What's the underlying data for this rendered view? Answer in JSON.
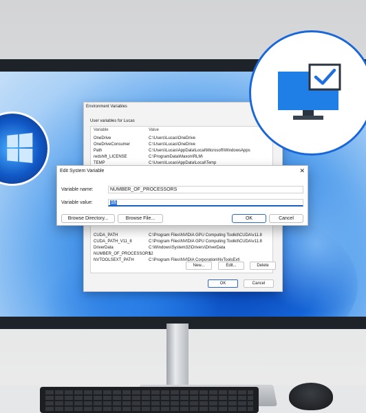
{
  "env_dialog": {
    "title": "Environment Variables",
    "group_label": "User variables for Lucas",
    "columns": {
      "variable": "Variable",
      "value": "Value"
    },
    "user_rows": [
      {
        "variable": "OneDrive",
        "value": "C:\\Users\\Lucas\\OneDrive"
      },
      {
        "variable": "OneDriveConsumer",
        "value": "C:\\Users\\Lucas\\OneDrive"
      },
      {
        "variable": "Path",
        "value": "C:\\Users\\Lucas\\AppData\\Local\\Microsoft\\WindowsApps"
      },
      {
        "variable": "redshift_LICENSE",
        "value": "C:\\ProgramData\\Maxon\\RLM\\"
      },
      {
        "variable": "TEMP",
        "value": "C:\\Users\\Lucas\\AppData\\Local\\Temp"
      }
    ],
    "system_rows": [
      {
        "variable": "CUDA_PATH",
        "value": "C:\\Program Files\\NVIDIA GPU Computing Toolkit\\CUDA\\v11.8"
      },
      {
        "variable": "CUDA_PATH_V11_8",
        "value": "C:\\Program Files\\NVIDIA GPU Computing Toolkit\\CUDA\\v11.8"
      },
      {
        "variable": "DriverData",
        "value": "C:\\Windows\\System32\\Drivers\\DriverData"
      },
      {
        "variable": "NUMBER_OF_PROCESSORS",
        "value": "12"
      },
      {
        "variable": "NVTOOLSEXT_PATH",
        "value": "C:\\Program Files\\NVIDIA Corporation\\NvToolsExt\\"
      }
    ],
    "buttons": {
      "new": "New...",
      "edit": "Edit...",
      "delete": "Delete",
      "ok": "OK",
      "cancel": "Cancel"
    }
  },
  "edit_dialog": {
    "title": "Edit System Variable",
    "close_glyph": "✕",
    "name_label": "Variable name:",
    "name_value": "NUMBER_OF_PROCESSORS",
    "value_label": "Variable value:",
    "value_value": "16",
    "buttons": {
      "browse_directory": "Browse Directory...",
      "browse_file": "Browse File...",
      "ok": "OK",
      "cancel": "Cancel"
    }
  },
  "colors": {
    "accent": "#1a67d8",
    "check": "#1e6fe0",
    "monitor_icon": "#1f7fe6"
  },
  "icons": {
    "badge": "monitor-check-icon",
    "windows": "windows-logo-icon"
  }
}
